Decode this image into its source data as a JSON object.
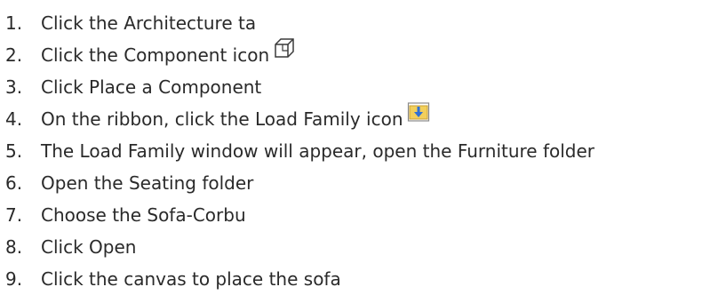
{
  "steps": [
    {
      "num": "1.",
      "text": "Click the Architecture ta"
    },
    {
      "num": "2.",
      "text": "Click the Component icon",
      "icon": "component-icon"
    },
    {
      "num": "3.",
      "text": "Click Place a Component"
    },
    {
      "num": "4.",
      "text": "On the ribbon, click the Load Family icon",
      "icon": "load-family-icon"
    },
    {
      "num": "5.",
      "text": "The Load Family window will appear, open the Furniture folder"
    },
    {
      "num": "6.",
      "text": "Open the Seating folder"
    },
    {
      "num": "7.",
      "text": "Choose the Sofa-Corbu"
    },
    {
      "num": "8.",
      "text": "Click Open"
    },
    {
      "num": "9.",
      "text": "Click the canvas to place the sofa"
    }
  ],
  "colors": {
    "text": "#2a2a2a",
    "load_family_arrow": "#2f6fd6",
    "load_family_folder": "#f2cf5b"
  }
}
